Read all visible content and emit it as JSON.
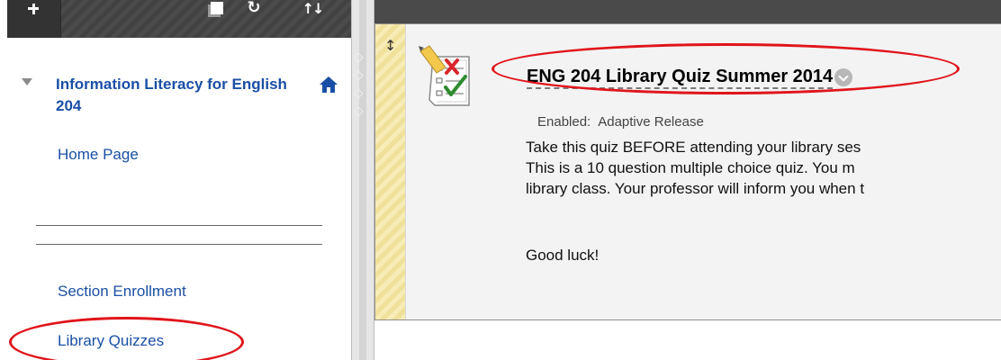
{
  "sidebar": {
    "course_title": "Information Literacy for English 204",
    "links": {
      "home_page": "Home Page",
      "section_enrollment": "Section Enrollment",
      "library_quizzes": "Library Quizzes"
    }
  },
  "content_item": {
    "title": "ENG 204 Library Quiz Summer 2014",
    "enabled_label": "Enabled:",
    "enabled_value": "Adaptive Release",
    "description": [
      "Take this quiz BEFORE attending your library ses",
      "This is a 10 question multiple choice quiz.  You m",
      "library class. Your professor will inform you when t"
    ],
    "closing": "Good luck!"
  },
  "colors": {
    "link": "#1a4fa6",
    "annotation_oval": "#e1141b",
    "toolbar": "#4a4a4a",
    "drag_strip": "#f7ecb5"
  },
  "icons": [
    "add-icon",
    "window-icon",
    "refresh-icon",
    "sort-icon",
    "home-icon",
    "expand-caret-icon",
    "drag-handle-icon",
    "quiz-icon",
    "options-chevron-icon"
  ]
}
